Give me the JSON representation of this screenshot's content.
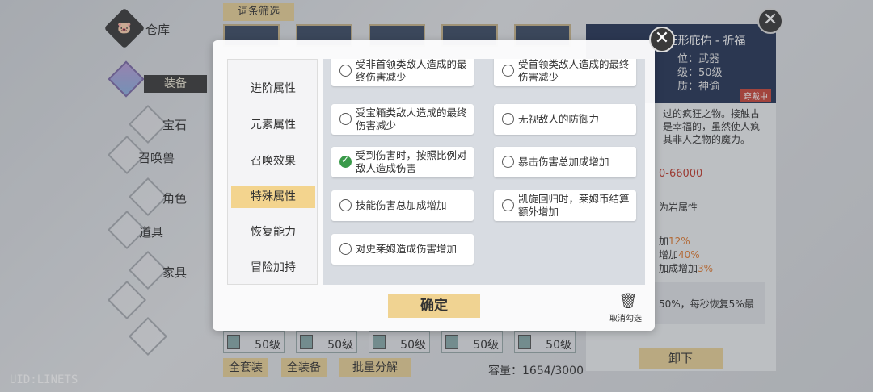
{
  "nav": {
    "warehouse": "仓库",
    "items": [
      "装备",
      "宝石",
      "召唤兽",
      "角色",
      "道具",
      "家具"
    ]
  },
  "uid": "UID:LINETS",
  "inventory": {
    "filter_label": "词条筛选",
    "level_label": "50级",
    "buttons": [
      "全套装",
      "全装备",
      "批量分解"
    ],
    "capacity": "容量：1654/3000"
  },
  "detail": {
    "title": "·无形庇佑 - 祈福",
    "rows": [
      "位：武器",
      "级：50级",
      "质：神谕"
    ],
    "equipped_badge": "穿戴中",
    "description": [
      "过的疯狂之物。接触古",
      "是幸福的，虽然使人疯",
      "其非人之物的魔力。"
    ],
    "stat_range": "0-66000",
    "attribute": "为岩属性",
    "bonus_lines": [
      {
        "prefix": "加",
        "value": "12%"
      },
      {
        "prefix": "增加",
        "value": "40%"
      },
      {
        "prefix": "加成增加",
        "value": "3%"
      }
    ],
    "recovery_text": "50%，每秒恢复5%最",
    "unequip_label": "卸下"
  },
  "modal": {
    "categories": [
      {
        "label": "进阶属性",
        "active": false
      },
      {
        "label": "元素属性",
        "active": false
      },
      {
        "label": "召唤效果",
        "active": false
      },
      {
        "label": "特殊属性",
        "active": true
      },
      {
        "label": "恢复能力",
        "active": false
      },
      {
        "label": "冒险加持",
        "active": false
      }
    ],
    "options": [
      {
        "text": "受非首领类敌人造成的最终伤害减少",
        "checked": false
      },
      {
        "text": "受首领类敌人造成的最终伤害减少",
        "checked": false
      },
      {
        "text": "受宝箱类敌人造成的最终伤害减少",
        "checked": false
      },
      {
        "text": "无视敌人的防御力",
        "checked": false
      },
      {
        "text": "受到伤害时，按照比例对敌人造成伤害",
        "checked": true
      },
      {
        "text": "暴击伤害总加成增加",
        "checked": false
      },
      {
        "text": "技能伤害总加成增加",
        "checked": false
      },
      {
        "text": "凯旋回归时，莱姆币结算额外增加",
        "checked": false
      },
      {
        "text": "对史莱姆造成伤害增加",
        "checked": false
      }
    ],
    "confirm_label": "确定",
    "clear_label": "取消勾选"
  }
}
